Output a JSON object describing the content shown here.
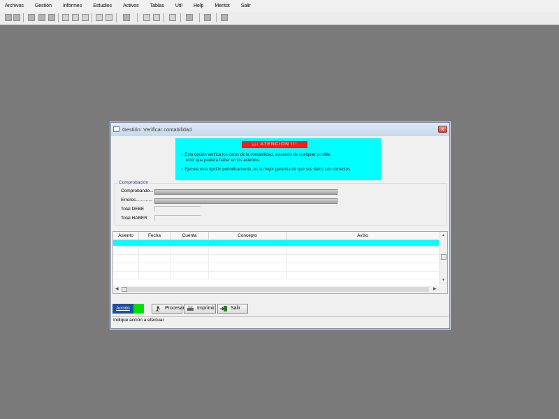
{
  "menubar": {
    "items": [
      "Archivos",
      "Gestión",
      "Informes",
      "Estudios",
      "Activos",
      "Tablas",
      "Util",
      "Help",
      "Mentot",
      "Salir"
    ]
  },
  "dialog": {
    "title": "Gestión: Verificar contabilidad",
    "close_label": "x",
    "notice": {
      "title": "¡¡¡ ATENCION !!!",
      "line1": "Esta opción verifica los datos de la contabilidad, avisando de cualquier posible",
      "line2": "error que pudiera haber en los asientos.",
      "line3": "Ejecute esta opción periodicamente, es la mejor garantía de que sus datos son correctos.",
      "bullet": "o",
      "color": "#00ffff",
      "title_color": "#ff1a1a"
    },
    "comprobacion": {
      "legend": "Comprobación",
      "comprobando_label": "Comprobando...",
      "errores_label": "Errores.............",
      "total_debe_label": "Total DEBE",
      "total_haber_label": "Total HABER"
    },
    "grid": {
      "columns": [
        "Asiento",
        "Fecha",
        "Cuenta",
        "Concepto",
        "Aviso"
      ],
      "selected_row_color": "#00ffff"
    },
    "actions": {
      "accion_label": "Acción",
      "procesar_label": "Procesar",
      "imprimir_label": "Imprimir",
      "salir_label": "Salir"
    },
    "status_text": "Indique acción a efectuar"
  }
}
